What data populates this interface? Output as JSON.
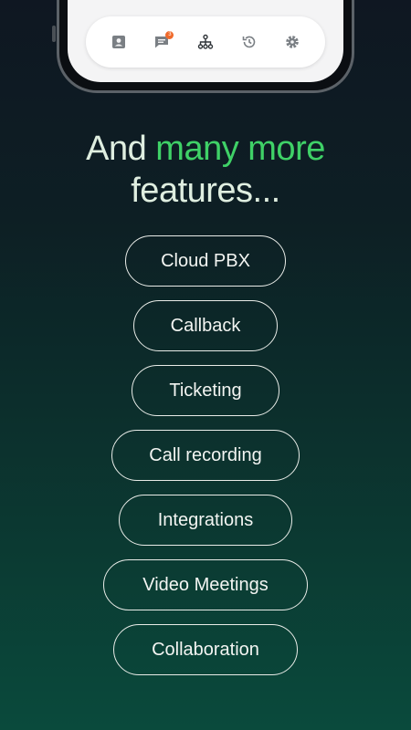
{
  "tabbar": {
    "items": [
      {
        "icon": "contacts-icon"
      },
      {
        "icon": "chat-icon",
        "badge": "3"
      },
      {
        "icon": "hierarchy-icon"
      },
      {
        "icon": "history-icon"
      },
      {
        "icon": "gear-icon"
      }
    ]
  },
  "headline": {
    "line1_plain": "And ",
    "line1_accent": "many more",
    "line2": "features..."
  },
  "features": [
    "Cloud PBX",
    "Callback",
    "Ticketing",
    "Call recording",
    "Integrations",
    "Video Meetings",
    "Collaboration"
  ],
  "colors": {
    "accent": "#3fd167",
    "headline": "#dfeee0",
    "badge": "#f06a2b"
  }
}
